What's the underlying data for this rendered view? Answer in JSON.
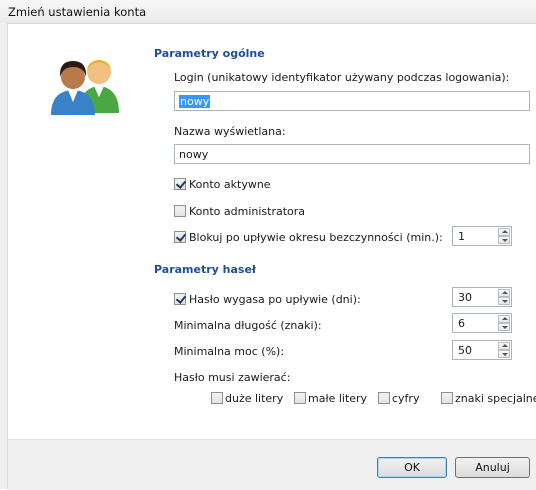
{
  "window": {
    "title": "Zmień ustawienia konta"
  },
  "general": {
    "heading": "Parametry ogólne",
    "login_label": "Login (unikatowy identyfikator używany podczas logowania):",
    "login_value": "nowy",
    "display_label": "Nazwa wyświetlana:",
    "display_value": "nowy",
    "active_label": "Konto aktywne",
    "active_checked": true,
    "admin_label": "Konto administratora",
    "admin_checked": false,
    "lock_label": "Blokuj po upływie okresu bezczynności (min.):",
    "lock_checked": true,
    "lock_value": "1"
  },
  "passwords": {
    "heading": "Parametry haseł",
    "expire_label": "Hasło wygasa po upływie (dni):",
    "expire_checked": true,
    "expire_value": "30",
    "minlen_label": "Minimalna długość (znaki):",
    "minlen_value": "6",
    "minstr_label": "Minimalna moc (%):",
    "minstr_value": "50",
    "must_label": "Hasło musi zawierać:",
    "options": [
      {
        "label": "duże litery",
        "checked": false
      },
      {
        "label": "małe litery",
        "checked": false
      },
      {
        "label": "cyfry",
        "checked": false
      },
      {
        "label": "znaki specjalne",
        "checked": false
      }
    ]
  },
  "buttons": {
    "ok": "OK",
    "cancel": "Anuluj"
  },
  "icon": "users-icon"
}
